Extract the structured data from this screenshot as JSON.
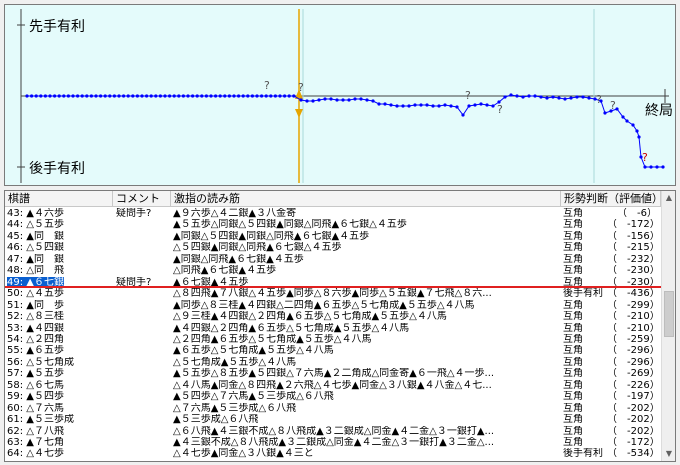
{
  "graph": {
    "top_label": "先手有利",
    "bottom_label": "後手有利",
    "end_label": "終局",
    "colors": {
      "background": "#e4fbfb",
      "line": "#0000ff",
      "question": "#555555",
      "bad_question": "#cc0000",
      "current_marker": "#e6a500"
    }
  },
  "table": {
    "headers": {
      "move": "棋譜",
      "comment": "コメント",
      "reading": "激指の読み筋",
      "judgement": "形勢判断（評価値）"
    },
    "rows": [
      {
        "move": "43: ▲４六歩",
        "comment": "疑問手?",
        "reading": "▲９六歩△４二銀▲３八金寄",
        "judgement": "互角",
        "eval": "（　-6）"
      },
      {
        "move": "44: △５五歩",
        "comment": "",
        "reading": "▲５五歩△同銀△５四銀▲同銀△同飛▲６七銀△４五歩",
        "judgement": "互角",
        "eval": "（　-172）"
      },
      {
        "move": "45: ▲同　銀",
        "comment": "",
        "reading": "▲同銀△５四銀▲同銀△同飛▲６七銀▲４五歩",
        "judgement": "互角",
        "eval": "（　-156）"
      },
      {
        "move": "46: △５四銀",
        "comment": "",
        "reading": "△５四銀▲同銀△同飛▲６七銀△４五歩",
        "judgement": "互角",
        "eval": "（　-215）"
      },
      {
        "move": "47: ▲同　銀",
        "comment": "",
        "reading": "▲同銀△同飛▲６七銀▲４五歩",
        "judgement": "互角",
        "eval": "（　-232）"
      },
      {
        "move": "48: △同　飛",
        "comment": "",
        "reading": "△同飛▲６七銀▲４五歩",
        "judgement": "互角",
        "eval": "（　-230）"
      },
      {
        "move": "49: ▲６七銀",
        "comment": "疑問手?",
        "reading": "▲６七銀▲４五歩",
        "judgement": "互角",
        "eval": "（　-230）",
        "selected": true
      },
      {
        "move": "50: △４五歩",
        "comment": "",
        "reading": "△８四飛▲７八銀△４五歩▲同歩△８六歩▲同歩△５五銀▲７七飛△８六...",
        "judgement": "後手有利",
        "eval": "（　-436）"
      },
      {
        "move": "51: ▲同　歩",
        "comment": "",
        "reading": "▲同歩△８三桂▲４四銀△二四角▲６五歩△５七角成▲５五歩△４八馬",
        "judgement": "互角",
        "eval": "（　-299）"
      },
      {
        "move": "52: △８三桂",
        "comment": "",
        "reading": "△９三桂▲４四銀△２四角▲６五歩△５七角成▲５五歩△４八馬",
        "judgement": "互角",
        "eval": "（　-210）"
      },
      {
        "move": "53: ▲４四銀",
        "comment": "",
        "reading": "▲４四銀△２四角▲６五歩△５七角成▲５五歩△４八馬",
        "judgement": "互角",
        "eval": "（　-210）"
      },
      {
        "move": "54: △２四角",
        "comment": "",
        "reading": "△２四角▲６五歩△５七角成▲５五歩△４八馬",
        "judgement": "互角",
        "eval": "（　-259）"
      },
      {
        "move": "55: ▲６五歩",
        "comment": "",
        "reading": "▲６五歩△５七角成▲５五歩△４八馬",
        "judgement": "互角",
        "eval": "（　-296）"
      },
      {
        "move": "56: △５七角成",
        "comment": "",
        "reading": "△５七角成▲５五歩△４八馬",
        "judgement": "互角",
        "eval": "（　-296）"
      },
      {
        "move": "57: ▲５五歩",
        "comment": "",
        "reading": "▲５五歩△８五歩▲５四銀△７六馬▲２二角成△同金寄▲６一飛△４一歩...",
        "judgement": "互角",
        "eval": "（　-269）"
      },
      {
        "move": "58: △６七馬",
        "comment": "",
        "reading": "△４八馬▲同金△８四飛▲２六飛△４七歩▲同金△３八銀▲４八金△４七...",
        "judgement": "互角",
        "eval": "（　-226）"
      },
      {
        "move": "59: ▲５四歩",
        "comment": "",
        "reading": "▲５四歩△７六馬▲５三歩成△６八飛",
        "judgement": "互角",
        "eval": "（　-197）"
      },
      {
        "move": "60: △７六馬",
        "comment": "",
        "reading": "△７六馬▲５三歩成△６八飛",
        "judgement": "互角",
        "eval": "（　-202）"
      },
      {
        "move": "61: ▲５三歩成",
        "comment": "",
        "reading": "▲５三歩成△６八飛",
        "judgement": "互角",
        "eval": "（　-202）"
      },
      {
        "move": "62: △７八飛",
        "comment": "",
        "reading": "△６八飛▲４三銀不成△８八飛成▲３二銀成△同金▲４二金△３一銀打▲...",
        "judgement": "互角",
        "eval": "（　-202）"
      },
      {
        "move": "63: ▲７七角",
        "comment": "",
        "reading": "▲４三銀不成△８八飛成▲３二銀成△同金▲４二金△３一銀打▲３二金△...",
        "judgement": "互角",
        "eval": "（　-172）"
      },
      {
        "move": "64: △４七歩",
        "comment": "",
        "reading": "△４七歩▲同金△３八銀▲４三と",
        "judgement": "後手有利",
        "eval": "（　-534）"
      }
    ]
  }
}
